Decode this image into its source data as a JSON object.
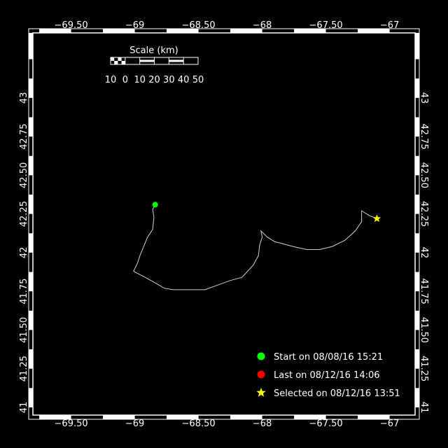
{
  "map": {
    "lon_ticks": [
      "−69.50",
      "−69",
      "−68.50",
      "−68",
      "−67.50",
      "−67"
    ],
    "lat_ticks": [
      "43",
      "42.75",
      "42.50",
      "42.25",
      "42",
      "41.75",
      "41.50",
      "41.25",
      "41"
    ],
    "lon_range": [
      -69.8,
      -66.8
    ],
    "lat_range": [
      40.95,
      43.42
    ],
    "track": [
      [
        -68.84,
        42.31
      ],
      [
        -68.86,
        42.28
      ],
      [
        -68.85,
        42.23
      ],
      [
        -68.86,
        42.15
      ],
      [
        -68.9,
        42.1
      ],
      [
        -68.93,
        42.04
      ],
      [
        -68.96,
        41.98
      ],
      [
        -68.98,
        41.93
      ],
      [
        -69.01,
        41.88
      ],
      [
        -68.99,
        41.87
      ],
      [
        -68.94,
        41.85
      ],
      [
        -68.83,
        41.8
      ],
      [
        -68.77,
        41.77
      ],
      [
        -68.7,
        41.76
      ],
      [
        -68.55,
        41.76
      ],
      [
        -68.45,
        41.76
      ],
      [
        -68.35,
        41.79
      ],
      [
        -68.25,
        41.82
      ],
      [
        -68.16,
        41.84
      ],
      [
        -68.07,
        41.92
      ],
      [
        -68.03,
        41.98
      ],
      [
        -68.02,
        42.05
      ],
      [
        -68.0,
        42.1
      ],
      [
        -68.01,
        42.14
      ],
      [
        -67.96,
        42.1
      ],
      [
        -67.9,
        42.07
      ],
      [
        -67.85,
        42.06
      ],
      [
        -67.76,
        42.04
      ],
      [
        -67.65,
        42.02
      ],
      [
        -67.55,
        42.02
      ],
      [
        -67.45,
        42.04
      ],
      [
        -67.35,
        42.08
      ],
      [
        -67.27,
        42.14
      ],
      [
        -67.22,
        42.2
      ],
      [
        -67.22,
        42.27
      ],
      [
        -67.16,
        42.24
      ],
      [
        -67.1,
        42.22
      ]
    ],
    "start_point": [
      -68.84,
      42.31
    ],
    "selected_point": [
      -67.1,
      42.22
    ],
    "scale_bar": {
      "title": "Scale (km)",
      "labels": [
        "10",
        "0",
        "10",
        "20",
        "30",
        "40",
        "50"
      ]
    },
    "legend": [
      {
        "marker": "circle",
        "color": "#00ff00",
        "text": "Start on 08/08/16 15:21"
      },
      {
        "marker": "circle",
        "color": "#ff0000",
        "text": "Last on 08/12/16 14:06"
      },
      {
        "marker": "star",
        "color": "#ffff00",
        "text": "Selected on 08/12/16 13:51"
      }
    ],
    "colors": {
      "background": "#000000",
      "frame": "#ffffff",
      "track": "#d0d0d0",
      "start": "#00ff00",
      "last": "#ff0000",
      "selected": "#ffff00"
    }
  }
}
